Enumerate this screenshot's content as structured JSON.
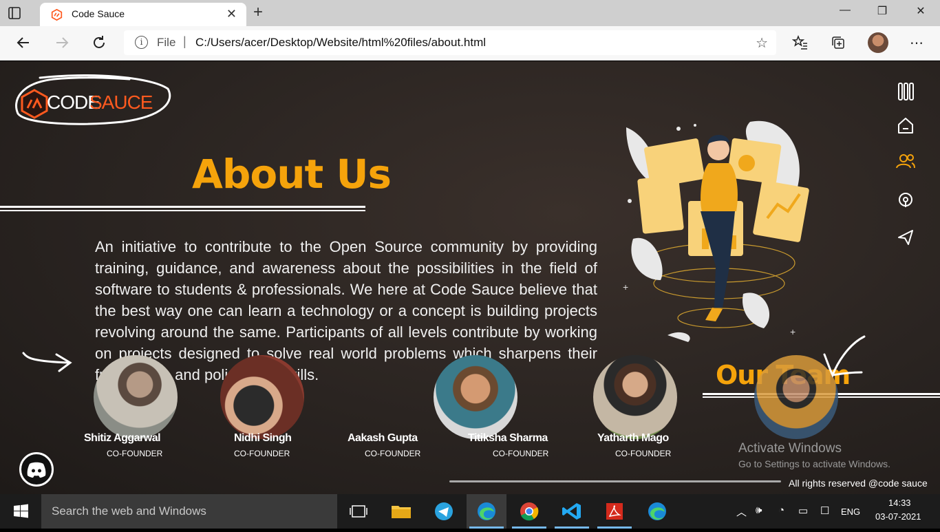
{
  "browser": {
    "tab_title": "Code Sauce",
    "address_scheme": "File",
    "address_separator": "|",
    "address_url": "C:/Users/acer/Desktop/Website/html%20files/about.html"
  },
  "site": {
    "logo_code": "CODE",
    "logo_sauce": "SAUCE",
    "about_title": "About Us",
    "about_text": "An initiative to contribute to the Open Source community by providing training, guidance, and awareness about the possibilities in the field of software to students & professionals. We here at Code Sauce believe that the best way one can learn a technology or a concept is building projects revolving around the same. Participants of all levels contribute by working on projects designed to solve real world problems which sharpens their future skills and polish their skills.",
    "team_title": "Our Team",
    "sidenav": [
      "menu-icon",
      "home-icon",
      "team-icon",
      "podcast-icon",
      "send-icon"
    ],
    "members": [
      {
        "name": "Shitiz Aggarwal",
        "role": "CO-FOUNDER"
      },
      {
        "name": "Nidhi Singh",
        "role": "CO-FOUNDER"
      },
      {
        "name": "Aakash Gupta",
        "role": "CO-FOUNDER"
      },
      {
        "name": "Titiksha Sharma",
        "role": "CO-FOUNDER"
      },
      {
        "name": "Yatharth Mago",
        "role": "CO-FOUNDER"
      }
    ],
    "footer": "All rights reserved @code sauce",
    "accent": "#f5a30b",
    "brand_orange": "#ff5a1f"
  },
  "os": {
    "activate_title": "Activate Windows",
    "activate_sub": "Go to Settings to activate Windows.",
    "search_placeholder": "Search the web and Windows",
    "language": "ENG",
    "time": "14:33",
    "date": "03-07-2021"
  }
}
